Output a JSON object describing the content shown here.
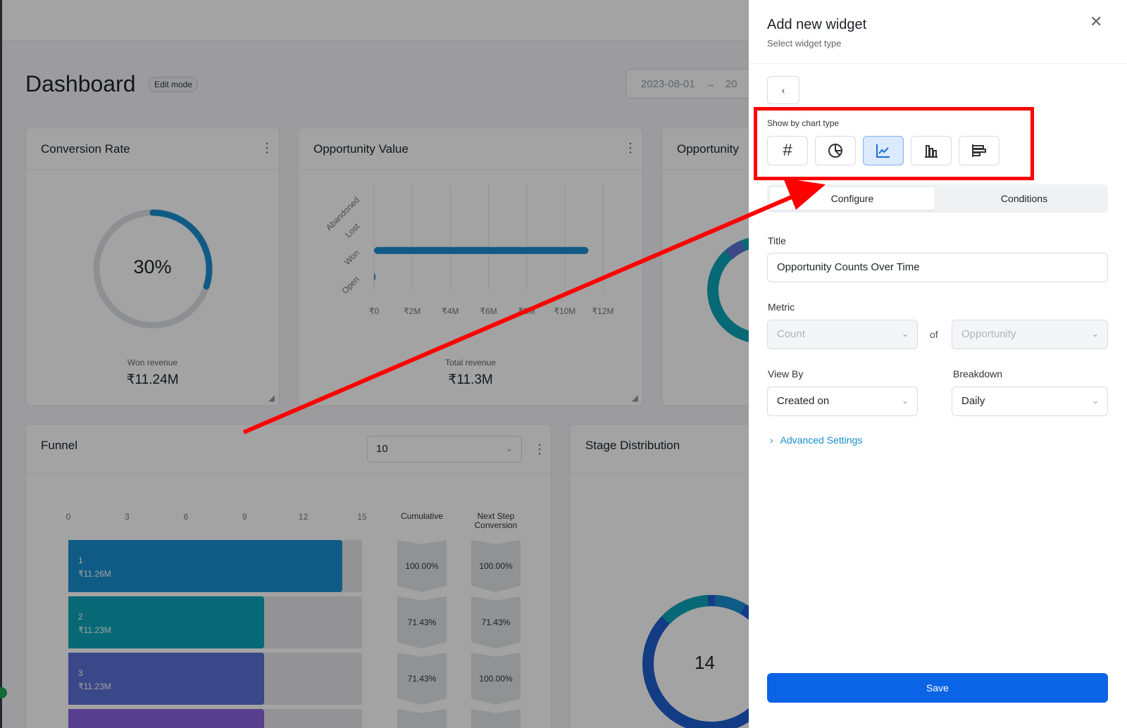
{
  "dashboard": {
    "title": "Dashboard",
    "mode_badge": "Edit mode",
    "date_from": "2023-08-01",
    "date_arrow": "→",
    "date_to": "20"
  },
  "cards": {
    "conversion_rate": {
      "title": "Conversion Rate",
      "percent_text": "30%",
      "percent_value": 30,
      "sublabel": "Won revenue",
      "value": "₹11.24M"
    },
    "opportunity_value": {
      "title": "Opportunity Value",
      "sublabel": "Total revenue",
      "value": "₹11.3M"
    },
    "opportunity_partial": {
      "title": "Opportunity"
    },
    "funnel": {
      "title": "Funnel",
      "select_value": "10",
      "col_cumulative": "Cumulative",
      "col_next_step_1": "Next Step",
      "col_next_step_2": "Conversion"
    },
    "stage_distribution": {
      "title": "Stage Distribution",
      "center_value": "14"
    }
  },
  "chart_data": [
    {
      "type": "bar",
      "orientation": "horizontal",
      "categories": [
        "Abandoned",
        "Lost",
        "Won",
        "Open"
      ],
      "values": [
        0,
        0,
        11240000,
        60000
      ],
      "tick_labels": [
        "₹0",
        "₹2M",
        "₹4M",
        "₹6M",
        "₹8M",
        "₹10M",
        "₹12M"
      ],
      "xlim": [
        0,
        12000000
      ],
      "color": "#1a8fd1"
    },
    {
      "type": "bar",
      "orientation": "horizontal",
      "x_ticks": [
        "0",
        "3",
        "6",
        "9",
        "12",
        "15"
      ],
      "xlim": [
        0,
        15
      ],
      "rows": [
        {
          "stage": "1",
          "amount": "₹11.26M",
          "value": 14,
          "cumulative": "100.00%",
          "next_step": "100.00%",
          "color": "#1a8fd1"
        },
        {
          "stage": "2",
          "amount": "₹11.23M",
          "value": 10,
          "cumulative": "71.43%",
          "next_step": "71.43%",
          "color": "#0aa5b8"
        },
        {
          "stage": "3",
          "amount": "₹11.23M",
          "value": 10,
          "cumulative": "71.43%",
          "next_step": "100.00%",
          "color": "#5b6fd6"
        },
        {
          "stage": "",
          "amount": "",
          "value": 10,
          "cumulative": "",
          "next_step": "",
          "color": "#8a63e0"
        }
      ]
    }
  ],
  "panel": {
    "title": "Add new widget",
    "subtitle": "Select widget type",
    "back_glyph": "‹",
    "close_glyph": "✕",
    "chart_type_label": "Show by chart type",
    "chart_types": [
      {
        "icon": "hash-icon",
        "glyph": "#",
        "active": false
      },
      {
        "icon": "pie-chart-icon",
        "active": false
      },
      {
        "icon": "line-chart-icon",
        "active": true
      },
      {
        "icon": "bar-chart-icon",
        "active": false
      },
      {
        "icon": "horizontal-bar-chart-icon",
        "active": false
      }
    ],
    "tabs": [
      "Configure",
      "Conditions"
    ],
    "title_label": "Title",
    "title_value": "Opportunity Counts Over Time",
    "metric_label": "Metric",
    "metric_value": "Count",
    "of_label": "of",
    "metric_object": "Opportunity",
    "view_by_label": "View By",
    "view_by_value": "Created on",
    "breakdown_label": "Breakdown",
    "breakdown_value": "Daily",
    "advanced_settings": "Advanced Settings",
    "save_label": "Save"
  },
  "annotation_color": "#ff0000"
}
